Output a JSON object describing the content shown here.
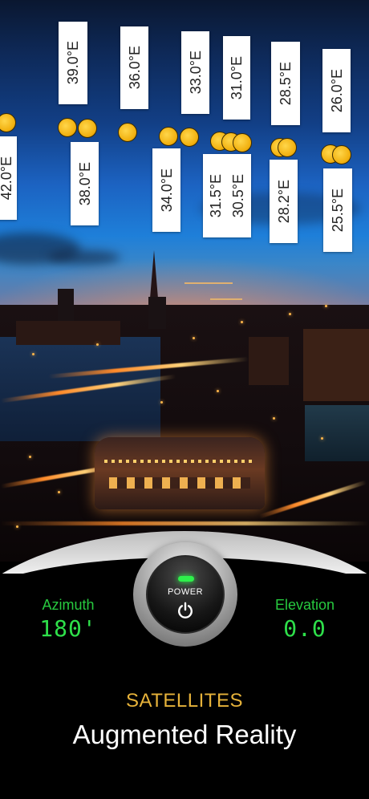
{
  "satellites": [
    {
      "label": "39.0°E"
    },
    {
      "label": "36.0°E"
    },
    {
      "label": "33.0°E"
    },
    {
      "label": "31.0°E"
    },
    {
      "label": "28.5°E"
    },
    {
      "label": "26.0°E"
    },
    {
      "label": "42.0°E"
    },
    {
      "label": "38.0°E"
    },
    {
      "label": "34.0°E"
    },
    {
      "label": "31.5°E"
    },
    {
      "label": "30.5°E"
    },
    {
      "label": "28.2°E"
    },
    {
      "label": "25.5°E"
    }
  ],
  "power": {
    "label": "POWER",
    "led_color": "#2ef04b"
  },
  "azimuth": {
    "title": "Azimuth",
    "value": "180'"
  },
  "elevation": {
    "title": "Elevation",
    "value": "0.0"
  },
  "footer": {
    "subtitle": "SATELLITES",
    "title": "Augmented Reality"
  },
  "colors": {
    "accent_green": "#27c93f",
    "subtitle_gold": "#e6b23a",
    "satellite_dot": "#f1b00f"
  }
}
